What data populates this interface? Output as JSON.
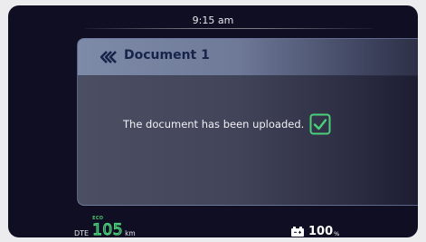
{
  "status_bar": {
    "time": "9:15 am"
  },
  "dialog": {
    "title": "Document 1",
    "back_icon": "double-chevron-left-icon",
    "message": "The document has been uploaded.",
    "status_icon": "checkbox-checked-icon"
  },
  "footer": {
    "dte_label": "DTE",
    "eco_label": "ECO",
    "dte_value": "105",
    "dte_unit": "km",
    "battery_icon": "battery-icon",
    "battery_value": "100",
    "battery_unit": "%"
  },
  "colors": {
    "background": "#0f0e22",
    "accent_green": "#4bd07a",
    "title_text": "#18234a"
  }
}
